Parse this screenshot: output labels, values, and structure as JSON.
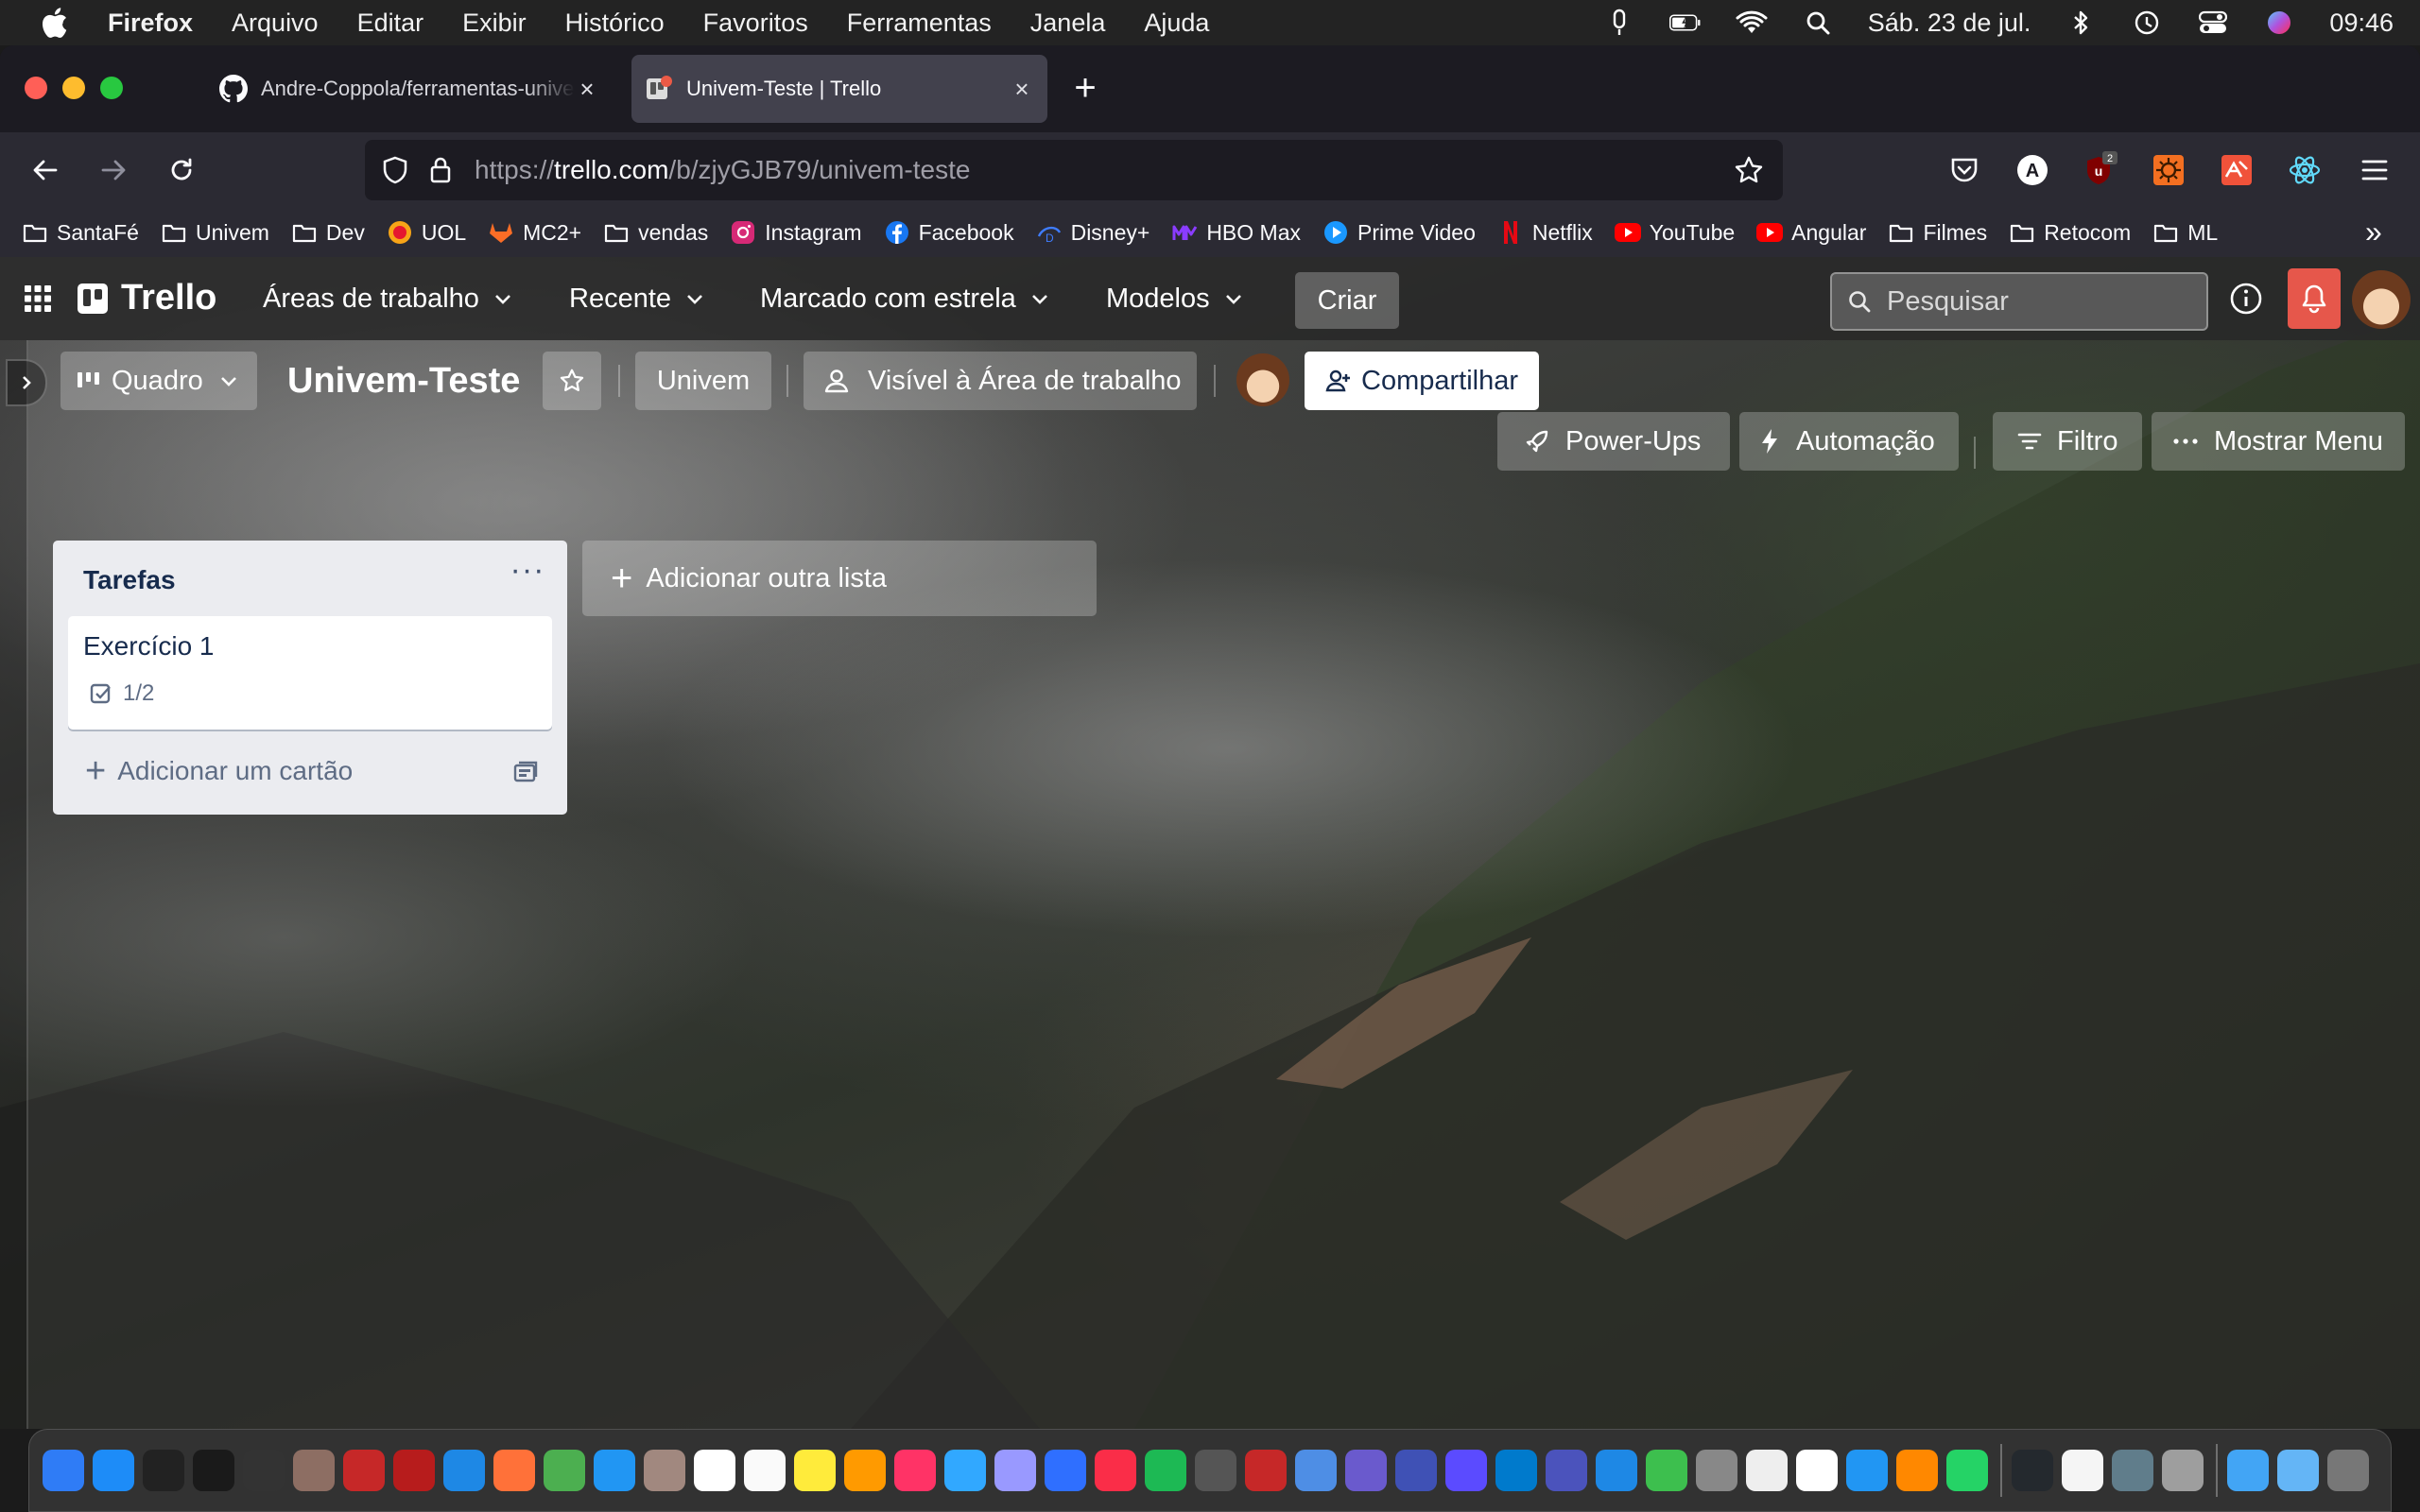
{
  "menubar": {
    "app_name": "Firefox",
    "items": [
      "Arquivo",
      "Editar",
      "Exibir",
      "Histórico",
      "Favoritos",
      "Ferramentas",
      "Janela",
      "Ajuda"
    ],
    "date": "Sáb. 23 de jul.",
    "time": "09:46"
  },
  "browser": {
    "tabs": [
      {
        "title": "Andre-Coppola/ferramentas-univem",
        "favicon": "github-icon",
        "active": false
      },
      {
        "title": "Univem-Teste | Trello",
        "favicon": "trello-icon",
        "active": true
      }
    ],
    "url_prefix": "https://",
    "url_domain": "trello.com",
    "url_path": "/b/zjyGJB79/univem-teste",
    "extension_badge": "2",
    "bookmarks": [
      {
        "label": "SantaFé",
        "icon": "folder-icon"
      },
      {
        "label": "Univem",
        "icon": "folder-icon"
      },
      {
        "label": "Dev",
        "icon": "folder-icon"
      },
      {
        "label": "UOL",
        "icon": "uol-icon"
      },
      {
        "label": "MC2+",
        "icon": "gitlab-icon"
      },
      {
        "label": "vendas",
        "icon": "folder-icon"
      },
      {
        "label": "Instagram",
        "icon": "instagram-icon"
      },
      {
        "label": "Facebook",
        "icon": "facebook-icon"
      },
      {
        "label": "Disney+",
        "icon": "disney-icon"
      },
      {
        "label": "HBO Max",
        "icon": "hbo-icon"
      },
      {
        "label": "Prime Video",
        "icon": "prime-icon"
      },
      {
        "label": "Netflix",
        "icon": "netflix-icon"
      },
      {
        "label": "YouTube",
        "icon": "youtube-icon"
      },
      {
        "label": "Angular",
        "icon": "youtube-icon"
      },
      {
        "label": "Filmes",
        "icon": "folder-icon"
      },
      {
        "label": "Retocom",
        "icon": "folder-icon"
      },
      {
        "label": "ML",
        "icon": "folder-icon"
      }
    ]
  },
  "trello": {
    "logo": "Trello",
    "nav": {
      "workspaces": "Áreas de trabalho",
      "recent": "Recente",
      "starred": "Marcado com estrela",
      "templates": "Modelos",
      "create": "Criar"
    },
    "search_placeholder": "Pesquisar",
    "board": {
      "view": "Quadro",
      "title": "Univem-Teste",
      "workspace": "Univem",
      "visibility": "Visível à Área de trabalho",
      "share": "Compartilhar",
      "powerups": "Power-Ups",
      "automation": "Automação",
      "filter": "Filtro",
      "show_menu": "Mostrar Menu"
    },
    "lists": [
      {
        "title": "Tarefas",
        "cards": [
          {
            "title": "Exercício 1",
            "checklist": "1/2"
          }
        ],
        "add_card": "Adicionar um cartão"
      }
    ],
    "add_list": "Adicionar outra lista"
  },
  "colors": {
    "accent_notification": "#e6574b",
    "list_bg": "#ebecf0",
    "text_dark": "#172b4d"
  }
}
